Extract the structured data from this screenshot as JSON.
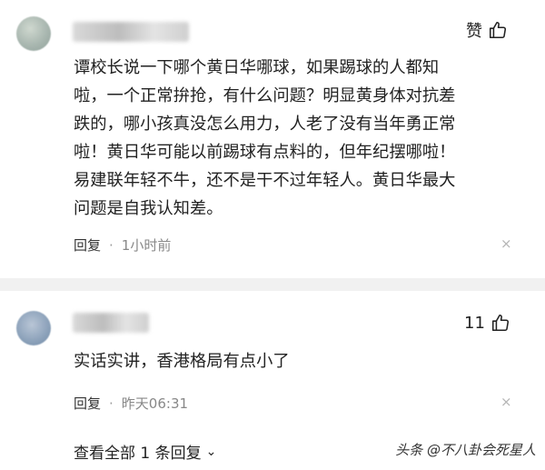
{
  "comment1": {
    "likes_label": "赞",
    "text_lines": [
      "谭校长说一下哪个黄日华哪球，如果踢球的人都知",
      "啦，一个正常拚抢，有什么问题？明显黄身体对抗差",
      "跌的，哪小孩真没怎么用力，人老了没有当年勇正常",
      "啦！黄日华可能以前踢球有点料的，但年纪摆哪啦！",
      "易建联年轻不牛，还不是干不过年轻人。黄日华最大",
      "问题是自我认知差。"
    ],
    "reply_label": "回复",
    "separator": "·",
    "time": "1小时前",
    "close": "×"
  },
  "comment2": {
    "likes": "11",
    "text": "实话实讲，香港格局有点小了",
    "reply_label": "回复",
    "separator": "·",
    "time": "昨天06:31",
    "close": "×",
    "view_replies": "查看全部 1 条回复",
    "chevron": "⌄"
  },
  "watermark": "头条 @不八卦会死星人"
}
